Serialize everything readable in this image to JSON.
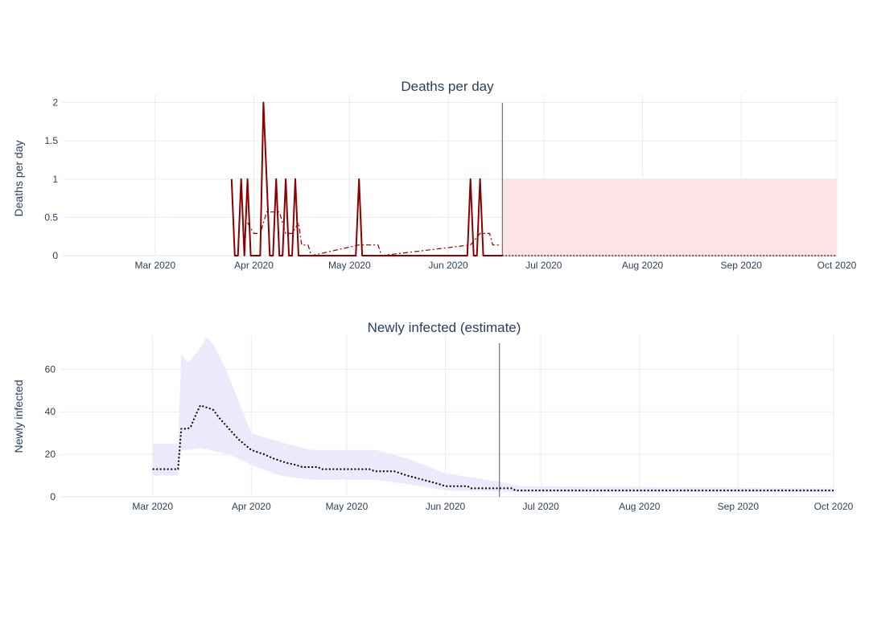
{
  "chart_data": [
    {
      "type": "line",
      "title": "Deaths per day",
      "ylabel": "Deaths per day",
      "xlabel": "",
      "xlim": [
        "2020-02-01",
        "2020-10-01"
      ],
      "ylim": [
        0,
        2.1
      ],
      "x_ticks": [
        "Mar 2020",
        "Apr 2020",
        "May 2020",
        "Jun 2020",
        "Jul 2020",
        "Aug 2020",
        "Sep 2020",
        "Oct 2020"
      ],
      "x_tick_dates": [
        "2020-03-01",
        "2020-04-01",
        "2020-05-01",
        "2020-06-01",
        "2020-07-01",
        "2020-08-01",
        "2020-09-01",
        "2020-10-01"
      ],
      "y_ticks": [
        "0",
        "0.5",
        "1",
        "1.5",
        "2"
      ],
      "y_tick_values": [
        0,
        0.5,
        1,
        1.5,
        2
      ],
      "vline_date": "2020-06-18",
      "grid": true,
      "colors": {
        "observed": "#8b0000",
        "smoothed": "#8b0000",
        "band": "#fde3e6",
        "vline": "#555555"
      },
      "series": [
        {
          "style": "solid",
          "points": [
            [
              "2020-03-25",
              1
            ],
            [
              "2020-03-26",
              0
            ],
            [
              "2020-03-27",
              0
            ],
            [
              "2020-03-28",
              1
            ],
            [
              "2020-03-29",
              0
            ],
            [
              "2020-03-30",
              1
            ],
            [
              "2020-03-31",
              0
            ],
            [
              "2020-04-01",
              0
            ],
            [
              "2020-04-02",
              0
            ],
            [
              "2020-04-03",
              0
            ],
            [
              "2020-04-04",
              2
            ],
            [
              "2020-04-05",
              1
            ],
            [
              "2020-04-06",
              0
            ],
            [
              "2020-04-07",
              0
            ],
            [
              "2020-04-08",
              1
            ],
            [
              "2020-04-09",
              0
            ],
            [
              "2020-04-10",
              0
            ],
            [
              "2020-04-11",
              1
            ],
            [
              "2020-04-12",
              0
            ],
            [
              "2020-04-13",
              0
            ],
            [
              "2020-04-14",
              1
            ],
            [
              "2020-04-15",
              0
            ],
            [
              "2020-04-16",
              0
            ],
            [
              "2020-04-30",
              0
            ],
            [
              "2020-05-01",
              0
            ],
            [
              "2020-05-02",
              0
            ],
            [
              "2020-05-03",
              0
            ],
            [
              "2020-05-04",
              1
            ],
            [
              "2020-05-05",
              0
            ],
            [
              "2020-05-06",
              0
            ],
            [
              "2020-06-06",
              0
            ],
            [
              "2020-06-07",
              0
            ],
            [
              "2020-06-08",
              1
            ],
            [
              "2020-06-09",
              0
            ],
            [
              "2020-06-10",
              0
            ],
            [
              "2020-06-11",
              1
            ],
            [
              "2020-06-12",
              0
            ],
            [
              "2020-06-13",
              0
            ],
            [
              "2020-06-18",
              0
            ]
          ]
        },
        {
          "style": "dashdot",
          "points": [
            [
              "2020-03-30",
              0.43
            ],
            [
              "2020-04-01",
              0.29
            ],
            [
              "2020-04-03",
              0.29
            ],
            [
              "2020-04-05",
              0.57
            ],
            [
              "2020-04-07",
              0.57
            ],
            [
              "2020-04-09",
              0.57
            ],
            [
              "2020-04-11",
              0.29
            ],
            [
              "2020-04-13",
              0.29
            ],
            [
              "2020-04-15",
              0.43
            ],
            [
              "2020-04-16",
              0.14
            ],
            [
              "2020-04-18",
              0.14
            ],
            [
              "2020-04-19",
              0
            ],
            [
              "2020-05-04",
              0.14
            ],
            [
              "2020-05-10",
              0.14
            ],
            [
              "2020-05-11",
              0
            ],
            [
              "2020-06-08",
              0.14
            ],
            [
              "2020-06-11",
              0.29
            ],
            [
              "2020-06-14",
              0.29
            ],
            [
              "2020-06-15",
              0.14
            ],
            [
              "2020-06-17",
              0.14
            ]
          ]
        },
        {
          "style": "dotted",
          "points": [
            [
              "2020-06-18",
              0
            ],
            [
              "2020-10-01",
              0
            ]
          ]
        }
      ],
      "band": {
        "x_start": "2020-06-18",
        "x_end": "2020-10-01",
        "y_low": 0,
        "y_high": 1
      }
    },
    {
      "type": "line",
      "title": "Newly infected (estimate)",
      "ylabel": "Newly infected",
      "xlabel": "",
      "xlim": [
        "2020-02-01",
        "2020-10-01"
      ],
      "ylim": [
        0,
        76
      ],
      "x_ticks": [
        "Mar 2020",
        "Apr 2020",
        "May 2020",
        "Jun 2020",
        "Jul 2020",
        "Aug 2020",
        "Sep 2020",
        "Oct 2020"
      ],
      "x_tick_dates": [
        "2020-03-01",
        "2020-04-01",
        "2020-05-01",
        "2020-06-01",
        "2020-07-01",
        "2020-08-01",
        "2020-09-01",
        "2020-10-01"
      ],
      "y_ticks": [
        "0",
        "20",
        "40",
        "60"
      ],
      "y_tick_values": [
        0,
        20,
        40,
        60
      ],
      "vline_date": "2020-06-18",
      "grid": true,
      "colors": {
        "line": "#000000",
        "band": "#ede9fd",
        "vline": "#555555"
      },
      "series": [
        {
          "style": "dotted",
          "points": [
            [
              "2020-03-01",
              13
            ],
            [
              "2020-03-09",
              13
            ],
            [
              "2020-03-10",
              32
            ],
            [
              "2020-03-12",
              32
            ],
            [
              "2020-03-13",
              33
            ],
            [
              "2020-03-15",
              40
            ],
            [
              "2020-03-16",
              43
            ],
            [
              "2020-03-18",
              42
            ],
            [
              "2020-03-20",
              41
            ],
            [
              "2020-03-22",
              37
            ],
            [
              "2020-03-25",
              32
            ],
            [
              "2020-03-28",
              27
            ],
            [
              "2020-04-01",
              22
            ],
            [
              "2020-04-05",
              20
            ],
            [
              "2020-04-08",
              18
            ],
            [
              "2020-04-12",
              16
            ],
            [
              "2020-04-15",
              15
            ],
            [
              "2020-04-17",
              14
            ],
            [
              "2020-04-22",
              14
            ],
            [
              "2020-04-23",
              13
            ],
            [
              "2020-05-06",
              13
            ],
            [
              "2020-05-08",
              13
            ],
            [
              "2020-05-10",
              12
            ],
            [
              "2020-05-16",
              12
            ],
            [
              "2020-05-20",
              10
            ],
            [
              "2020-05-25",
              8
            ],
            [
              "2020-05-30",
              6
            ],
            [
              "2020-06-01",
              5
            ],
            [
              "2020-06-08",
              5
            ],
            [
              "2020-06-09",
              4
            ],
            [
              "2020-06-22",
              4
            ],
            [
              "2020-06-23",
              3
            ],
            [
              "2020-10-01",
              3
            ]
          ]
        }
      ],
      "band_upper": [
        [
          "2020-03-01",
          25
        ],
        [
          "2020-03-09",
          25
        ],
        [
          "2020-03-10",
          67
        ],
        [
          "2020-03-12",
          63
        ],
        [
          "2020-03-15",
          68
        ],
        [
          "2020-03-18",
          75
        ],
        [
          "2020-03-20",
          72
        ],
        [
          "2020-03-24",
          60
        ],
        [
          "2020-03-28",
          45
        ],
        [
          "2020-04-01",
          30
        ],
        [
          "2020-04-05",
          28
        ],
        [
          "2020-04-12",
          25
        ],
        [
          "2020-04-20",
          22
        ],
        [
          "2020-05-10",
          22
        ],
        [
          "2020-05-20",
          18
        ],
        [
          "2020-06-01",
          11
        ],
        [
          "2020-06-10",
          9
        ],
        [
          "2020-06-18",
          7
        ],
        [
          "2020-06-25",
          5
        ],
        [
          "2020-10-01",
          4
        ]
      ],
      "band_lower": [
        [
          "2020-03-01",
          10
        ],
        [
          "2020-03-09",
          10
        ],
        [
          "2020-03-10",
          22
        ],
        [
          "2020-03-12",
          22
        ],
        [
          "2020-03-16",
          23
        ],
        [
          "2020-03-25",
          20
        ],
        [
          "2020-04-01",
          15
        ],
        [
          "2020-04-10",
          10
        ],
        [
          "2020-04-20",
          8
        ],
        [
          "2020-05-10",
          8
        ],
        [
          "2020-05-20",
          6
        ],
        [
          "2020-06-01",
          3
        ],
        [
          "2020-06-18",
          2.5
        ],
        [
          "2020-06-25",
          2
        ],
        [
          "2020-10-01",
          2
        ]
      ]
    }
  ]
}
